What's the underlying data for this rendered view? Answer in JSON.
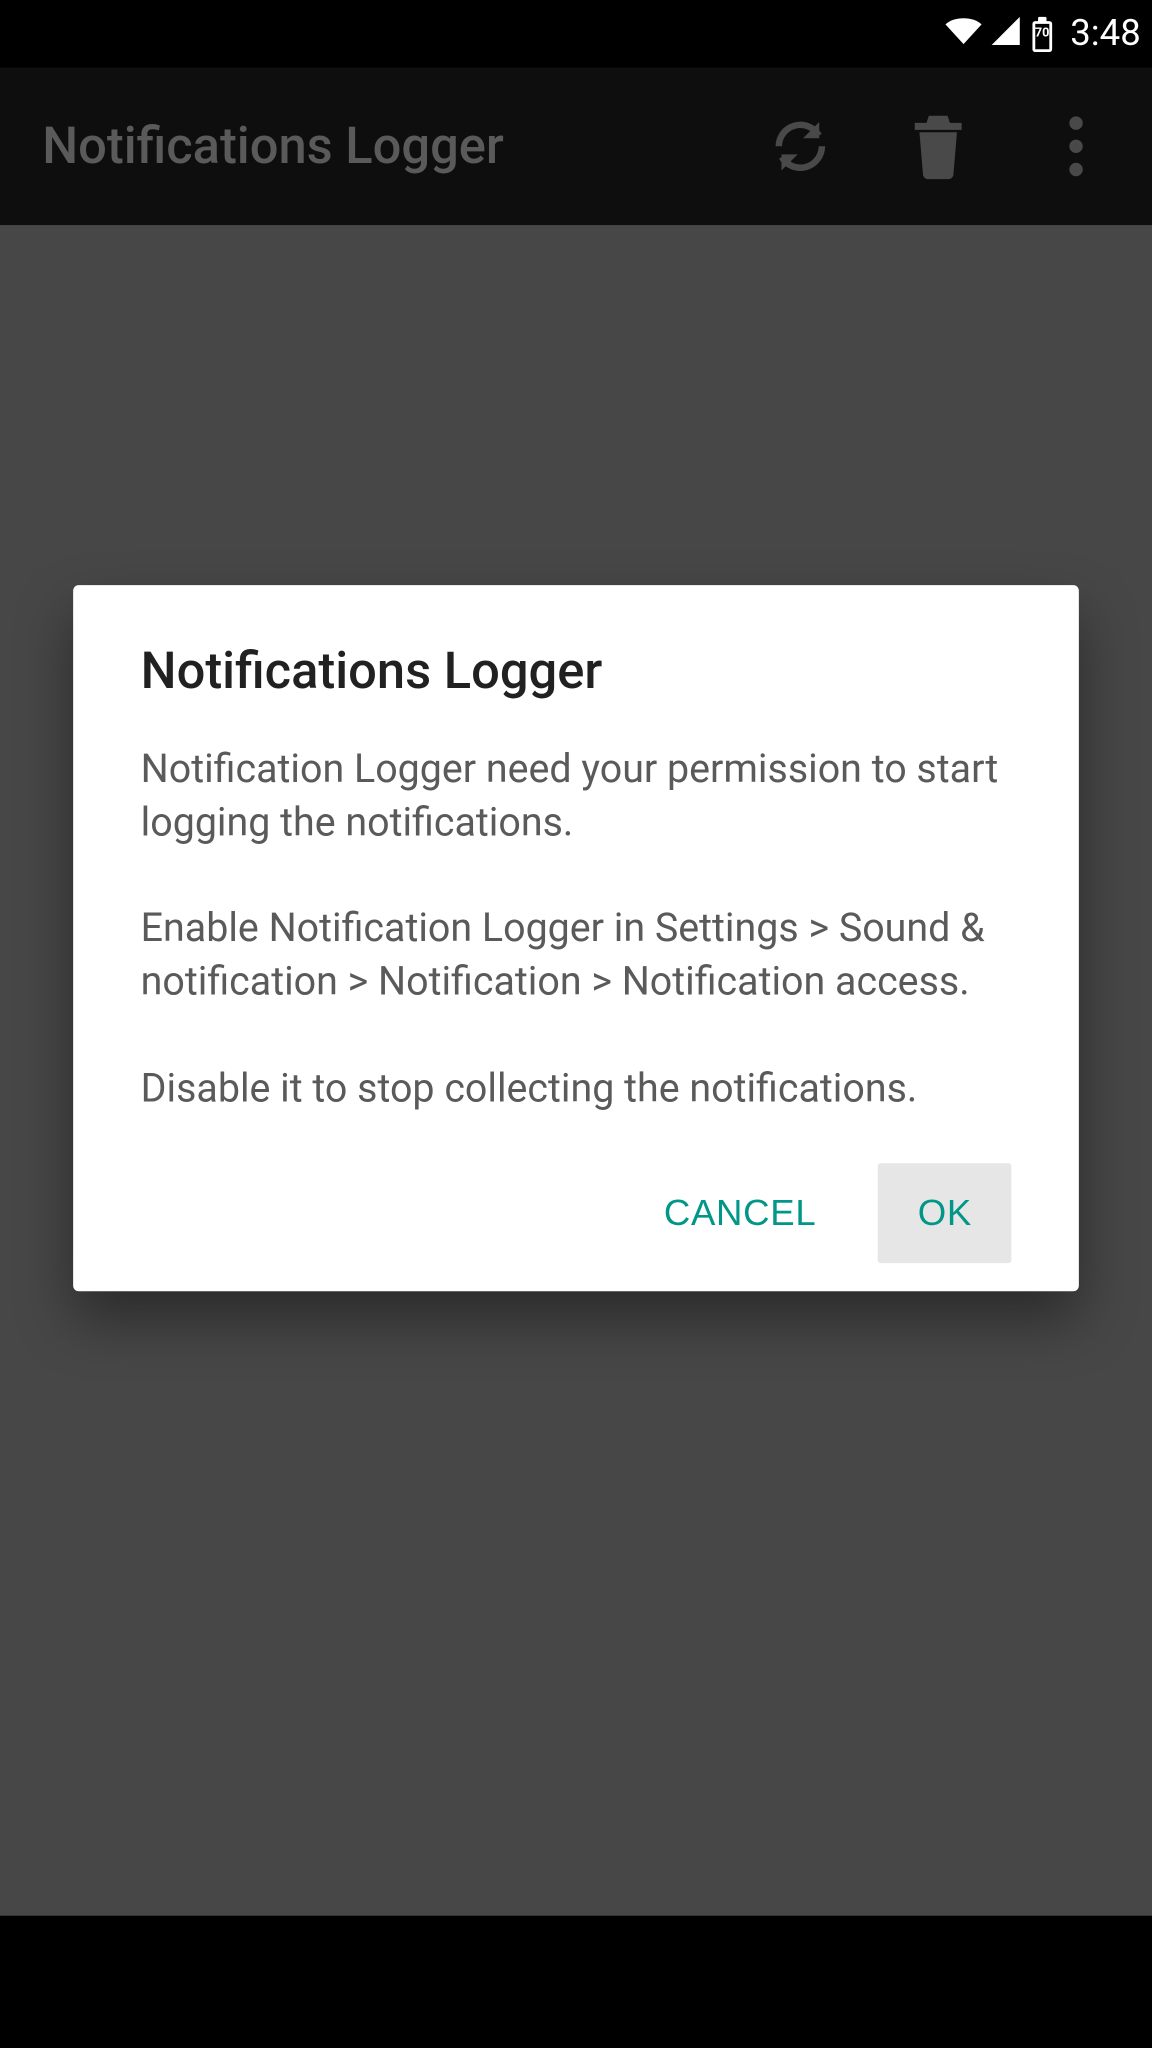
{
  "status": {
    "battery_level": "70",
    "time": "3:48"
  },
  "appbar": {
    "title": "Notifications Logger"
  },
  "dialog": {
    "title": "Notifications Logger",
    "body": "Notification Logger need your permission to start logging the notifications.\n\nEnable Notification Logger in Settings > Sound & notification > Notification > Notification access.\n\nDisable it to stop collecting the notifications.",
    "cancel_label": "CANCEL",
    "ok_label": "OK"
  }
}
